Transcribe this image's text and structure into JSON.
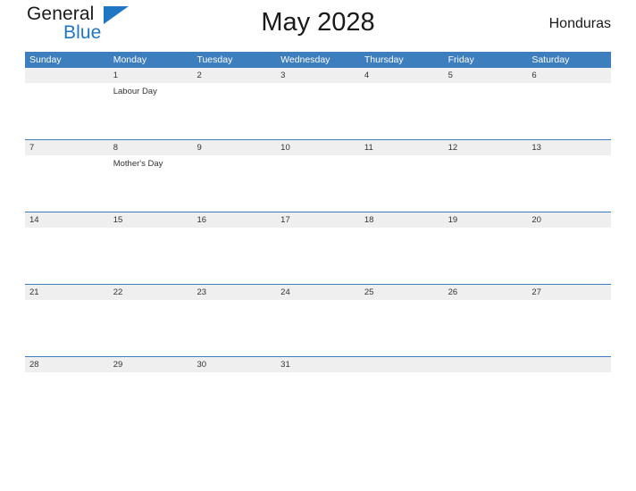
{
  "brand": {
    "name_part1": "General",
    "name_part2": "Blue",
    "triangle_color": "#1f77c4"
  },
  "header": {
    "title": "May 2028",
    "country": "Honduras",
    "header_bg": "#3d7ebf",
    "row_band_bg": "#efefef"
  },
  "calendar": {
    "month": "May",
    "year": 2028,
    "weekday_headers": [
      "Sunday",
      "Monday",
      "Tuesday",
      "Wednesday",
      "Thursday",
      "Friday",
      "Saturday"
    ],
    "weeks": [
      {
        "days": [
          {
            "num": "",
            "event": ""
          },
          {
            "num": "1",
            "event": "Labour Day"
          },
          {
            "num": "2",
            "event": ""
          },
          {
            "num": "3",
            "event": ""
          },
          {
            "num": "4",
            "event": ""
          },
          {
            "num": "5",
            "event": ""
          },
          {
            "num": "6",
            "event": ""
          }
        ]
      },
      {
        "days": [
          {
            "num": "7",
            "event": ""
          },
          {
            "num": "8",
            "event": "Mother's Day"
          },
          {
            "num": "9",
            "event": ""
          },
          {
            "num": "10",
            "event": ""
          },
          {
            "num": "11",
            "event": ""
          },
          {
            "num": "12",
            "event": ""
          },
          {
            "num": "13",
            "event": ""
          }
        ]
      },
      {
        "days": [
          {
            "num": "14",
            "event": ""
          },
          {
            "num": "15",
            "event": ""
          },
          {
            "num": "16",
            "event": ""
          },
          {
            "num": "17",
            "event": ""
          },
          {
            "num": "18",
            "event": ""
          },
          {
            "num": "19",
            "event": ""
          },
          {
            "num": "20",
            "event": ""
          }
        ]
      },
      {
        "days": [
          {
            "num": "21",
            "event": ""
          },
          {
            "num": "22",
            "event": ""
          },
          {
            "num": "23",
            "event": ""
          },
          {
            "num": "24",
            "event": ""
          },
          {
            "num": "25",
            "event": ""
          },
          {
            "num": "26",
            "event": ""
          },
          {
            "num": "27",
            "event": ""
          }
        ]
      },
      {
        "days": [
          {
            "num": "28",
            "event": ""
          },
          {
            "num": "29",
            "event": ""
          },
          {
            "num": "30",
            "event": ""
          },
          {
            "num": "31",
            "event": ""
          },
          {
            "num": "",
            "event": ""
          },
          {
            "num": "",
            "event": ""
          },
          {
            "num": "",
            "event": ""
          }
        ]
      }
    ]
  }
}
